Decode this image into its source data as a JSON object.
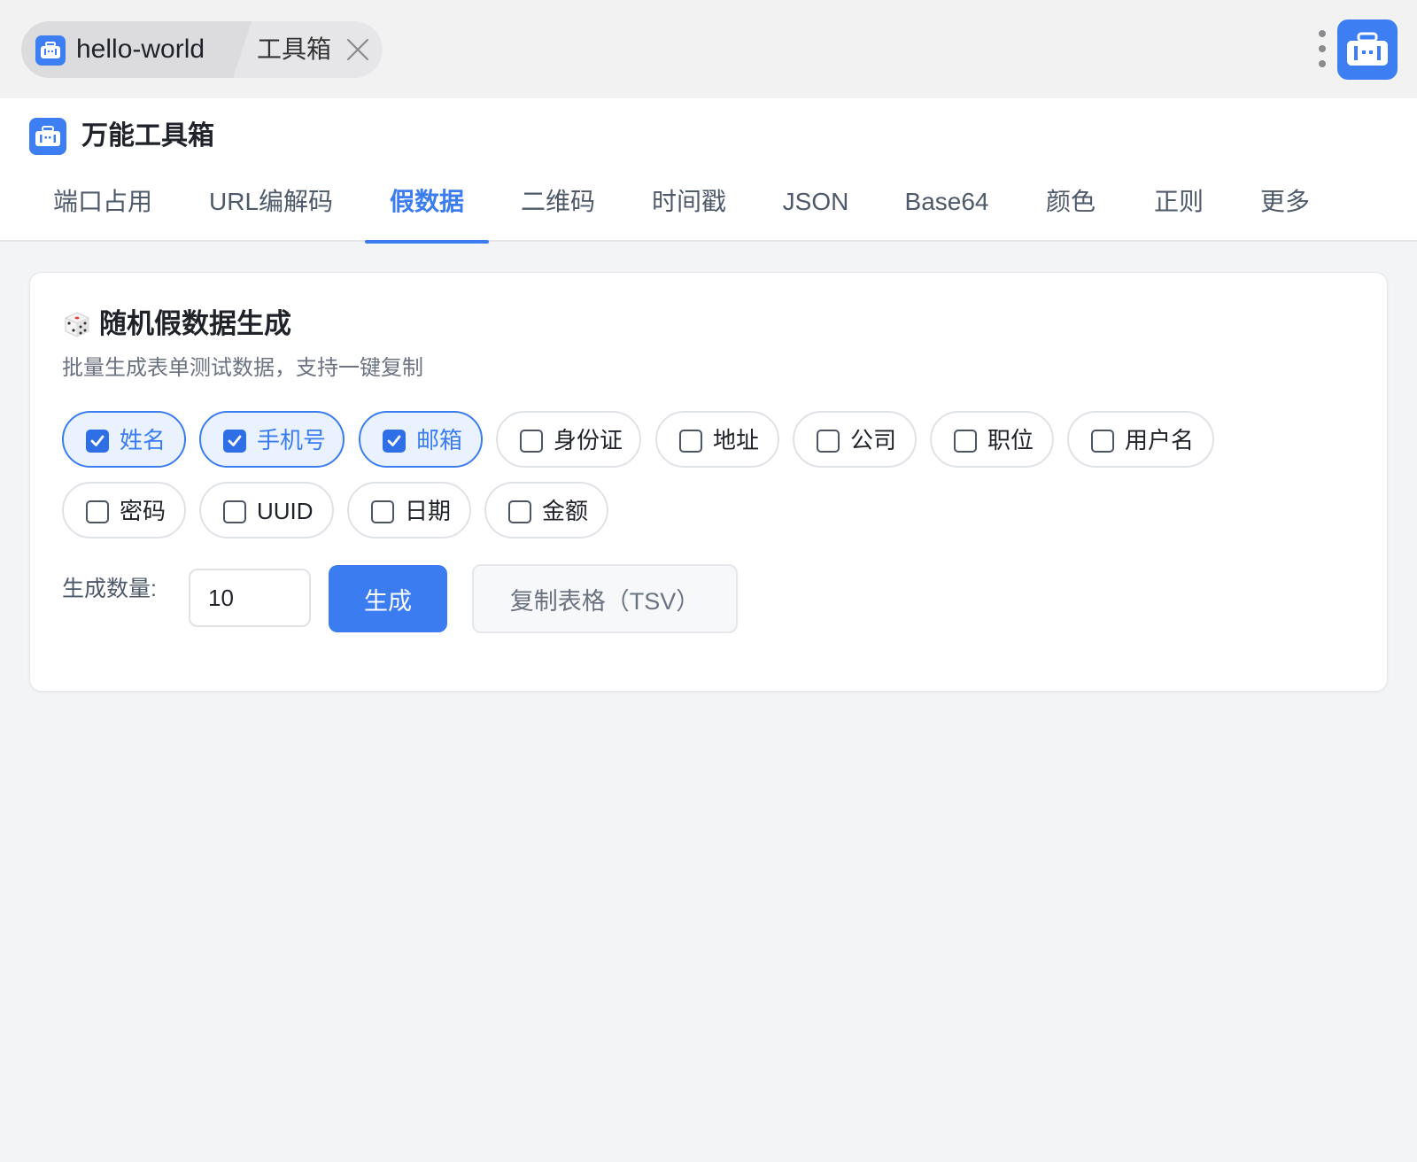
{
  "window": {
    "breadcrumb_app": "hello-world",
    "breadcrumb_tool": "工具箱"
  },
  "header": {
    "title": "万能工具箱"
  },
  "tabs": [
    {
      "label": "端口占用",
      "active": false
    },
    {
      "label": "URL编解码",
      "active": false
    },
    {
      "label": "假数据",
      "active": true
    },
    {
      "label": "二维码",
      "active": false
    },
    {
      "label": "时间戳",
      "active": false
    },
    {
      "label": "JSON",
      "active": false
    },
    {
      "label": "Base64",
      "active": false
    },
    {
      "label": "颜色",
      "active": false
    },
    {
      "label": "正则",
      "active": false
    },
    {
      "label": "更多",
      "active": false
    }
  ],
  "card": {
    "title": "随机假数据生成",
    "subtitle": "批量生成表单测试数据，支持一键复制",
    "fields": [
      {
        "label": "姓名",
        "checked": true
      },
      {
        "label": "手机号",
        "checked": true
      },
      {
        "label": "邮箱",
        "checked": true
      },
      {
        "label": "身份证",
        "checked": false
      },
      {
        "label": "地址",
        "checked": false
      },
      {
        "label": "公司",
        "checked": false
      },
      {
        "label": "职位",
        "checked": false
      },
      {
        "label": "用户名",
        "checked": false
      },
      {
        "label": "密码",
        "checked": false
      },
      {
        "label": "UUID",
        "checked": false
      },
      {
        "label": "日期",
        "checked": false
      },
      {
        "label": "金额",
        "checked": false
      }
    ],
    "count_label": "生成数量:",
    "count_value": "10",
    "generate_label": "生成",
    "copy_label": "复制表格（TSV）"
  },
  "colors": {
    "accent": "#3b7cf0",
    "accent_light": "#eaf2ff"
  }
}
